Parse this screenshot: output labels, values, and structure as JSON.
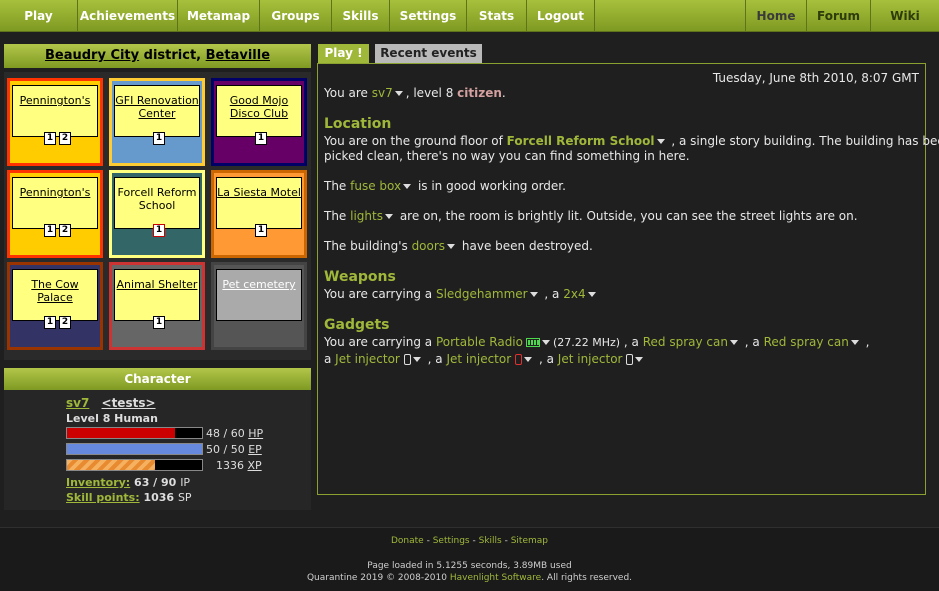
{
  "nav": {
    "left": [
      "Play",
      "Achievements",
      "Metamap",
      "Groups",
      "Skills",
      "Settings",
      "Stats",
      "Logout"
    ],
    "right": [
      "Home",
      "Forum",
      "Wiki"
    ]
  },
  "district": {
    "district_name": "Beaudry City",
    "district_word": "district,",
    "suburb": "Betaville"
  },
  "map": {
    "cells": [
      {
        "name": "Pennington's",
        "counts": [
          "1",
          "2"
        ],
        "bg": "#ffcc00",
        "border": "#ff3300",
        "linked": true
      },
      {
        "name": "GFI Renovation Center",
        "counts": [
          "1"
        ],
        "bg": "#6699cc",
        "border": "#ffcc33",
        "linked": true
      },
      {
        "name": "Good Mojo Disco Club",
        "counts": [
          "1"
        ],
        "bg": "#660066",
        "border": "#000066",
        "linked": true
      },
      {
        "name": "Pennington's",
        "counts": [
          "1",
          "2"
        ],
        "bg": "#ffcc00",
        "border": "#ff3300",
        "linked": true
      },
      {
        "name": "Forcell Reform School",
        "counts": [
          "1"
        ],
        "bg": "#336666",
        "border": "#ffff80",
        "linked": false
      },
      {
        "name": "La Siesta Motel",
        "counts": [
          "1"
        ],
        "bg": "#ff9933",
        "border": "#cc6600",
        "linked": true
      },
      {
        "name": "The Cow Palace",
        "counts": [
          "1",
          "2"
        ],
        "bg": "#333366",
        "border": "#993300",
        "linked": true
      },
      {
        "name": "Animal Shelter",
        "counts": [
          "1"
        ],
        "bg": "#666666",
        "border": "#cc3333",
        "linked": true
      },
      {
        "name": "Pet cemetery",
        "counts": [],
        "bg": "#555555",
        "border": "#444444",
        "linked": true
      }
    ]
  },
  "character": {
    "header": "Character",
    "name": "sv7",
    "group": "<tests>",
    "level_line": "Level 8 Human",
    "hp": {
      "value": "48 / 60",
      "unit": "HP",
      "fraction": 0.8,
      "color": "#cc0000"
    },
    "ep": {
      "value": "50 / 50",
      "unit": "EP",
      "fraction": 1.0,
      "color": "#6688dd"
    },
    "xp": {
      "value": "1336",
      "unit": "XP",
      "fraction": 0.65,
      "color": "#f0a050"
    },
    "inventory_label": "Inventory:",
    "inventory_value": "63 / 90",
    "inventory_unit": "IP",
    "skill_label": "Skill points:",
    "skill_value": "1036",
    "skill_unit": "SP"
  },
  "tabs": {
    "play": "Play !",
    "recent": "Recent events"
  },
  "main": {
    "datetime": "Tuesday, June 8th 2010, 8:07 GMT",
    "intro": {
      "pre": "You are ",
      "name": "sv7",
      "mid": ", level 8 ",
      "title": "citizen",
      "post": "."
    },
    "location_title": "Location",
    "loc1": {
      "pre": "You are on the ground floor of ",
      "place": "Forcell Reform School",
      "post": " , a single story building. The building has been"
    },
    "loc2": "picked clean, there's no way you can find something in here.",
    "fuse": {
      "pre": "The ",
      "item": "fuse box",
      "post": " is in good working order."
    },
    "lights": {
      "pre": "The ",
      "item": "lights",
      "post": " are on, the room is brightly lit. Outside, you can see the street lights are on."
    },
    "doors": {
      "pre": "The building's ",
      "item": "doors",
      "post": " have been destroyed."
    },
    "weapons_title": "Weapons",
    "weapons": {
      "pre": "You are carrying a ",
      "w1": "Sledgehammer",
      "sep": " , a ",
      "w2": "2x4"
    },
    "gadgets_title": "Gadgets",
    "gadgets1": {
      "pre": "You are carrying a ",
      "g1": "Portable Radio",
      "freq": "(27.22 MHz)",
      "sep1": " , a ",
      "g2": "Red spray can",
      "sep2": " , a ",
      "g3": "Red spray can",
      "post": " ,"
    },
    "gadgets2": {
      "pre": "a ",
      "g1": "Jet injector",
      "sep1": " , a ",
      "g2": "Jet injector",
      "sep2": " , a ",
      "g3": "Jet injector"
    }
  },
  "footer": {
    "links": [
      "Donate",
      "Settings",
      "Skills",
      "Sitemap"
    ],
    "sep": " - ",
    "loaded": "Page loaded in 5.1255 seconds, 3.89MB used",
    "copy_pre": "Quarantine 2019 © 2008-2010 ",
    "copy_link": "Havenlight Software",
    "copy_post": ". All rights reserved."
  },
  "colors": {
    "accent": "#9fb83a",
    "bg": "#1f1f1f"
  }
}
